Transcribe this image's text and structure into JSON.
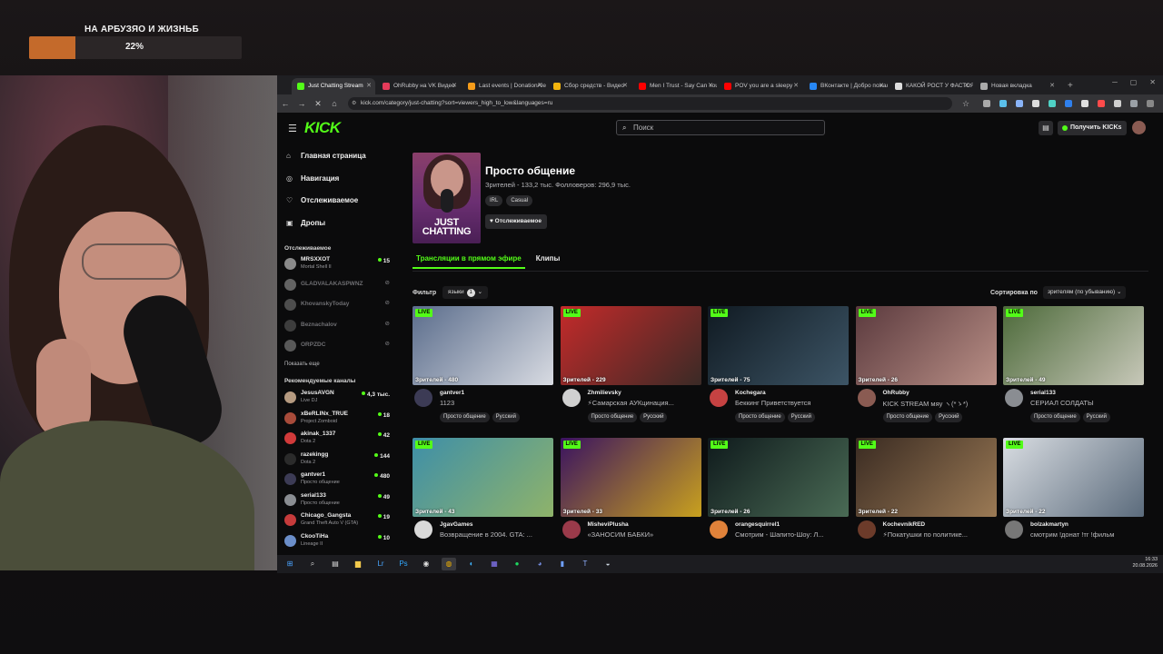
{
  "overlay": {
    "goal_title": "НА АРБУЗЯО И ЖИЗНЬБ",
    "goal_percent_text": "22%",
    "goal_progress": 0.22
  },
  "browser": {
    "tabs": [
      {
        "label": "Just Chatting Stream",
        "favicon": "kick",
        "color": "#53fc18",
        "active": true
      },
      {
        "label": "OhRubby на VK Видео",
        "favicon": "vk-video",
        "color": "#e53b5a"
      },
      {
        "label": "Last events | DonationAlerts",
        "favicon": "donationalerts",
        "color": "#f59c1a"
      },
      {
        "label": "Сбор средств - Видео",
        "favicon": "boosty",
        "color": "#f2b40e"
      },
      {
        "label": "Men I Trust - Say Can You Hear",
        "favicon": "youtube",
        "color": "#ff0000"
      },
      {
        "label": "POV you are a sleepy",
        "favicon": "youtube",
        "color": "#ff0000"
      },
      {
        "label": "ВКонтакте | Добро пожаловать",
        "favicon": "vk",
        "color": "#2787f5"
      },
      {
        "label": "КАКОЙ РОСТ У ФАСТОЯ",
        "favicon": "google",
        "color": "#dddddd"
      },
      {
        "label": "Новая вкладка",
        "favicon": "chrome",
        "color": "#aaaaaa"
      }
    ],
    "new_tab": "+",
    "url": "kick.com/category/just-chatting?sort=viewers_high_to_low&languages=ru"
  },
  "kick": {
    "logo": "KICK",
    "search_placeholder": "Поиск",
    "get_kicks": "Получить KICKs",
    "nav": [
      {
        "icon": "home-icon",
        "glyph": "⌂",
        "label": "Главная страница"
      },
      {
        "icon": "compass-icon",
        "glyph": "◎",
        "label": "Навигация"
      },
      {
        "icon": "heart-icon",
        "glyph": "♡",
        "label": "Отслеживаемое"
      },
      {
        "icon": "drops-icon",
        "glyph": "▣",
        "label": "Дропы"
      }
    ],
    "following_title": "Отслеживаемое",
    "following": [
      {
        "name": "MRSXXOT",
        "game": "Mortal Shell II",
        "viewers": "15",
        "live": true,
        "color": "#8a8a8a"
      },
      {
        "name": "GLADVALAKASPWNZ",
        "game": "",
        "viewers": "",
        "live": false,
        "color": "#cfcfcf"
      },
      {
        "name": "KhovanskyToday",
        "game": "",
        "viewers": "",
        "live": false,
        "color": "#9e9e9e"
      },
      {
        "name": "Beznachalov",
        "game": "",
        "viewers": "",
        "live": false,
        "color": "#7b7b7b"
      },
      {
        "name": "ORPZDC",
        "game": "",
        "viewers": "",
        "live": false,
        "color": "#b9b9b9"
      }
    ],
    "show_more": "Показать еще",
    "recommended_title": "Рекомендуемые каналы",
    "recommended": [
      {
        "name": "JesusAVGN",
        "game": "Live DJ",
        "viewers": "4,3 тыс.",
        "color": "#b59a80"
      },
      {
        "name": "xBeRLINx_TRUE",
        "game": "Project Zomboid",
        "viewers": "18",
        "color": "#a84b3a"
      },
      {
        "name": "akinak_1337",
        "game": "Dota 2",
        "viewers": "42",
        "color": "#d13a3a"
      },
      {
        "name": "razekingg",
        "game": "Dota 2",
        "viewers": "144",
        "color": "#2b2b2b"
      },
      {
        "name": "gantver1",
        "game": "Просто общение",
        "viewers": "480",
        "color": "#3c3b55"
      },
      {
        "name": "serial133",
        "game": "Просто общение",
        "viewers": "49",
        "color": "#8a8d92"
      },
      {
        "name": "Chicago_Gangsta",
        "game": "Grand Theft Auto V (GTA)",
        "viewers": "19",
        "color": "#c63b3b"
      },
      {
        "name": "CkooTiHa",
        "game": "Lineage II",
        "viewers": "10",
        "color": "#6b8ec9"
      }
    ],
    "category": {
      "poster_text": "JUST CHATTING",
      "title": "Просто общение",
      "stats": "Зрителей - 133,2 тыс.  Фолловеров: 296,9 тыс.",
      "tags": [
        "IRL",
        "Casual"
      ],
      "follow_button": "Отслеживаемое"
    },
    "tabs": [
      "Трансляции в прямом эфире",
      "Клипы"
    ],
    "filter_label": "Фильтр",
    "lang_dropdown": "языки",
    "lang_count": "1",
    "sort_label": "Сортировка по",
    "sort_value": "зрителям (по убыванию)",
    "live_badge": "LIVE",
    "streams": [
      {
        "views": "Зрителей - 480",
        "channel": "gantver1",
        "title": "1123",
        "tags": [
          "Просто общение",
          "Русский"
        ],
        "thumb_color": "#5b6d8c",
        "thumb_color2": "#d8dbe2",
        "avatar": "#3c3b55"
      },
      {
        "views": "Зрителей - 229",
        "channel": "Zhmilievsky",
        "title": "⚡Самарская АУКцинация...",
        "tags": [
          "Просто общение",
          "Русский"
        ],
        "thumb_color": "#c42a2a",
        "thumb_color2": "#3a2a26",
        "avatar": "#d0d0d0"
      },
      {
        "views": "Зрителей - 75",
        "channel": "Kochegara",
        "title": "Беккинг Приветствуется",
        "tags": [
          "Просто общение",
          "Русский"
        ],
        "thumb_color": "#101a22",
        "thumb_color2": "#3d5566",
        "avatar": "#c64242"
      },
      {
        "views": "Зрителей - 26",
        "channel": "OhRubby",
        "title": "KICK STREAM мяу ヽ(*ゝ*)",
        "tags": [
          "Просто общение",
          "Русский"
        ],
        "thumb_color": "#5b3a3e",
        "thumb_color2": "#b98f86",
        "avatar": "#8a5b52"
      },
      {
        "views": "Зрителей - 49",
        "channel": "serial133",
        "title": "СЕРИАЛ СОЛДАТЫ",
        "tags": [
          "Просто общение",
          "Русский"
        ],
        "thumb_color": "#4d6a3a",
        "thumb_color2": "#c7c8b9",
        "avatar": "#8a8d92"
      },
      {
        "views": "Зрителей - 43",
        "channel": "JgavGames",
        "title": "Возвращение в 2004. GTA: ...",
        "tags": [],
        "thumb_color": "#3e8fa8",
        "thumb_color2": "#8fb36a",
        "avatar": "#d9d9d9"
      },
      {
        "views": "Зрителей - 33",
        "channel": "MisheviPlusha",
        "title": "«ЗАНОСИМ БАБКИ»",
        "tags": [],
        "thumb_color": "#3a1360",
        "thumb_color2": "#c9a11e",
        "avatar": "#9a3a4a"
      },
      {
        "views": "Зрителей - 26",
        "channel": "orangesquirrel1",
        "title": "Смотрим - Шапито-Шоу: Л...",
        "tags": [],
        "thumb_color": "#0f1a1c",
        "thumb_color2": "#4a6b55",
        "avatar": "#e0823a"
      },
      {
        "views": "Зрителей - 22",
        "channel": "KochevnikRED",
        "title": "⚡Покатушки по политике...",
        "tags": [],
        "thumb_color": "#3a2b22",
        "thumb_color2": "#9b7a55",
        "avatar": "#6c3b2a"
      },
      {
        "views": "Зрителей - 22",
        "channel": "bolzakmartyn",
        "title": "смотрим !донат !тг !фильм",
        "tags": [],
        "thumb_color": "#d9dde2",
        "thumb_color2": "#5b6b7c",
        "avatar": "#777"
      }
    ]
  },
  "taskbar": {
    "items": [
      {
        "name": "windows-start-icon",
        "glyph": "⊞",
        "color": "#4aa3ff"
      },
      {
        "name": "search-icon",
        "glyph": "⌕",
        "color": "#ddd"
      },
      {
        "name": "task-view-icon",
        "glyph": "▤",
        "color": "#ddd"
      },
      {
        "name": "file-explorer-icon",
        "glyph": "▆",
        "color": "#f2c94c"
      },
      {
        "name": "lightroom-icon",
        "glyph": "Lr",
        "color": "#49a7ff"
      },
      {
        "name": "photoshop-icon",
        "glyph": "Ps",
        "color": "#31a8ff"
      },
      {
        "name": "obs-icon",
        "glyph": "◉",
        "color": "#ddd"
      },
      {
        "name": "chrome-icon",
        "glyph": "◍",
        "color": "#f4b400",
        "active": true
      },
      {
        "name": "edge-icon",
        "glyph": "◐",
        "color": "#3fb5ff"
      },
      {
        "name": "app-grid-icon",
        "glyph": "▦",
        "color": "#8a7bff"
      },
      {
        "name": "spotify-icon",
        "glyph": "●",
        "color": "#1ed760"
      },
      {
        "name": "discord-icon",
        "glyph": "◕",
        "color": "#7289da"
      },
      {
        "name": "stats-icon",
        "glyph": "▮",
        "color": "#6fa0ff"
      },
      {
        "name": "text-app-icon",
        "glyph": "T",
        "color": "#8fb0ff"
      },
      {
        "name": "steam-icon",
        "glyph": "◒",
        "color": "#cfd8e3"
      }
    ],
    "time": "16:33",
    "date": "20.08.2026"
  }
}
